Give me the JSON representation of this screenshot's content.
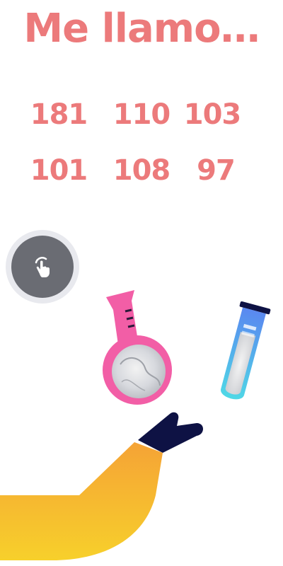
{
  "title": "Me llamo…",
  "codes": {
    "row1": [
      "181",
      "110",
      "103"
    ],
    "row2": [
      "101",
      "108",
      "97"
    ]
  },
  "icons": {
    "hint": "tap-hand-icon",
    "flask": "round-flask-icon",
    "tube": "test-tube-icon",
    "arm": "robotic-arm-icon"
  },
  "colors": {
    "accent": "#ec7a7b",
    "button_outer": "#e8e9ee",
    "button_inner": "#6a6c73",
    "flask": "#f25ea6",
    "tube_top": "#5a88f0",
    "tube_bottom": "#4fd8e6",
    "arm_top": "#f5a336",
    "arm_bottom": "#f7d02b",
    "gripper": "#0e1244"
  }
}
